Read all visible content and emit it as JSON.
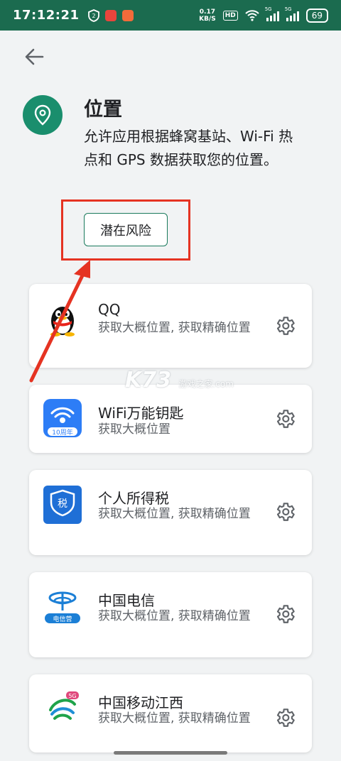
{
  "status_bar": {
    "time": "17:12:21",
    "net_speed_value": "0.17",
    "net_speed_unit": "KB/S",
    "hd_label": "HD",
    "signal_tag_1": "5G",
    "signal_tag_2": "5G",
    "battery": "69"
  },
  "header": {
    "title": "位置",
    "description": "允许应用根据蜂窝基站、Wi-Fi 热点和 GPS 数据获取您的位置。",
    "risk_button": "潜在风险"
  },
  "apps": [
    {
      "name": "QQ",
      "permission": "获取大概位置, 获取精确位置"
    },
    {
      "name": "WiFi万能钥匙",
      "permission": "获取大概位置",
      "icon_badge": "10周年"
    },
    {
      "name": "个人所得税",
      "permission": "获取大概位置, 获取精确位置",
      "icon_text": "税"
    },
    {
      "name": "中国电信",
      "permission": "获取大概位置, 获取精确位置",
      "icon_text": "电信营"
    },
    {
      "name": "中国移动江西",
      "permission": "获取大概位置, 获取精确位置",
      "icon_badge": "5G"
    }
  ],
  "watermark": {
    "text": "K73",
    "sub": "游戏之家",
    "domain": ".com"
  },
  "colors": {
    "status_bar": "#1b6b4f",
    "accent": "#1a8e6d",
    "annotation_red": "#e53322"
  }
}
